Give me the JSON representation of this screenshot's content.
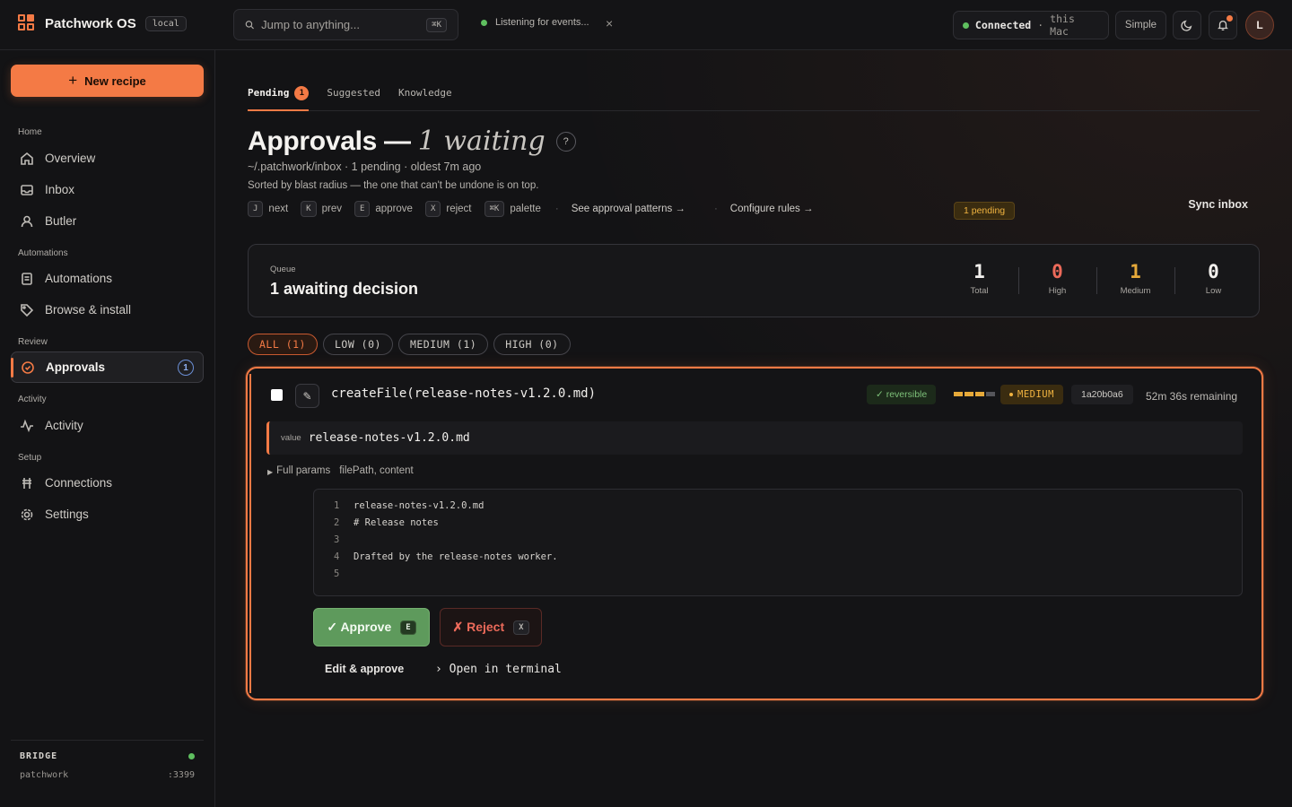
{
  "app": {
    "name": "Patchwork OS",
    "env_tag": "local"
  },
  "search": {
    "placeholder": "Jump to anything...",
    "shortcut": "⌘K"
  },
  "status": {
    "listening": "Listening for events...",
    "close": "×"
  },
  "connection": {
    "state": "Connected",
    "separator": "·",
    "target": "this Mac"
  },
  "header": {
    "mode_label": "Simple",
    "avatar_initial": "L"
  },
  "sidebar": {
    "new_recipe": "New recipe",
    "sections": {
      "home": "Home",
      "automations": "Automations",
      "review": "Review",
      "activity": "Activity",
      "setup": "Setup"
    },
    "items": {
      "overview": "Overview",
      "inbox": "Inbox",
      "butler": "Butler",
      "automations": "Automations",
      "browse": "Browse & install",
      "approvals": "Approvals",
      "approvals_count": "1",
      "activity": "Activity",
      "connections": "Connections",
      "settings": "Settings"
    },
    "bridge": {
      "title": "BRIDGE",
      "name": "patchwork",
      "port": ":3399"
    }
  },
  "tabs": {
    "pending": "Pending",
    "pending_count": "1",
    "suggested": "Suggested",
    "knowledge": "Knowledge"
  },
  "page": {
    "title": "Approvals —",
    "title_italic": "1 waiting",
    "help": "?",
    "subline": "~/.patchwork/inbox · 1 pending · oldest 7m ago",
    "sortline": "Sorted by blast radius — the one that can't be undone is on top.",
    "pending_pill": "1 pending",
    "sync": "Sync inbox"
  },
  "shortcuts": [
    {
      "key": "J",
      "label": "next"
    },
    {
      "key": "K",
      "label": "prev"
    },
    {
      "key": "E",
      "label": "approve"
    },
    {
      "key": "X",
      "label": "reject"
    },
    {
      "key": "⌘K",
      "label": "palette"
    }
  ],
  "links": {
    "dot": "·",
    "patterns": "See approval patterns →",
    "rules": "Configure rules →"
  },
  "queue": {
    "label": "Queue",
    "title": "1 awaiting decision",
    "stats": {
      "total": {
        "n": "1",
        "l": "Total"
      },
      "high": {
        "n": "0",
        "l": "High"
      },
      "medium": {
        "n": "1",
        "l": "Medium"
      },
      "low": {
        "n": "0",
        "l": "Low"
      }
    },
    "colors": {
      "total": "#f2f0ed",
      "high": "#ec6a5a",
      "medium": "#e6a93a",
      "low": "#f2f0ed"
    }
  },
  "filters": {
    "all": "ALL (1)",
    "low": "LOW (0)",
    "medium": "MEDIUM (1)",
    "high": "HIGH (0)"
  },
  "card": {
    "icon": "✎",
    "title": "createFile(release-notes-v1.2.0.md)",
    "reversible": "✓ reversible",
    "risk_level": 3,
    "risk_max": 4,
    "risk": "MEDIUM",
    "hash": "1a20b0a6",
    "remaining": "52m 36s remaining",
    "value_key": "value",
    "value": "release-notes-v1.2.0.md",
    "params_label": "Full params",
    "params_fields": "filePath, content",
    "code": [
      {
        "ln": "1",
        "text": "release-notes-v1.2.0.md"
      },
      {
        "ln": "2",
        "text": "# Release notes"
      },
      {
        "ln": "3",
        "text": ""
      },
      {
        "ln": "4",
        "text": "Drafted by the release-notes worker."
      },
      {
        "ln": "5",
        "text": ""
      }
    ],
    "approve": "✓ Approve",
    "approve_key": "E",
    "reject": "✗ Reject",
    "reject_key": "X",
    "edit": "Edit & approve",
    "terminal": "› Open in terminal"
  },
  "colors": {
    "accent": "#f47a45",
    "success": "#5e9a5c",
    "danger": "#ec6a5a",
    "warning": "#f0b340"
  }
}
